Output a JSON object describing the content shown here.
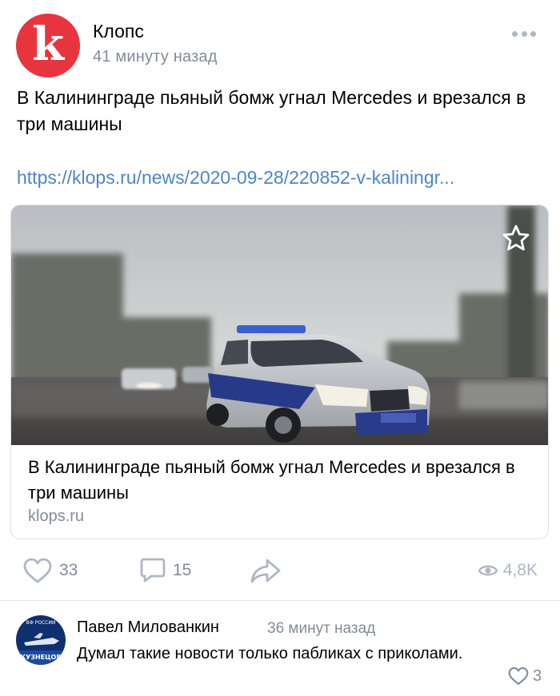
{
  "post": {
    "author": "Клопс",
    "avatar_letter": "k",
    "time": "41 минуту назад",
    "text": "В Калининграде пьяный бомж угнал Mercedes и врезался в три машины",
    "link": "https://klops.ru/news/2020-09-28/220852-v-kaliningr..."
  },
  "card": {
    "title": "В Калининграде пьяный бомж угнал Mercedes и врезался в три машины",
    "domain": "klops.ru"
  },
  "actions": {
    "likes": "33",
    "comments": "15",
    "views": "4,8K"
  },
  "comment": {
    "author": "Павел Милованкин",
    "time": "36 минут назад",
    "text": "Думал такие новости только пабликах с приколами.",
    "likes": "3",
    "avatar_text_top": "ВФ РОССИИ",
    "avatar_text_bottom": "КУЗНЕЦОВ"
  },
  "colors": {
    "brand": "#e8343f",
    "link": "#4986cc",
    "secondary_text": "#818c99",
    "icon": "#aeb7c2"
  },
  "icons": {
    "more": "more-horizontal-icon",
    "like": "heart-icon",
    "comment": "comment-icon",
    "share": "share-icon",
    "views": "eye-icon",
    "fave": "star-icon"
  }
}
